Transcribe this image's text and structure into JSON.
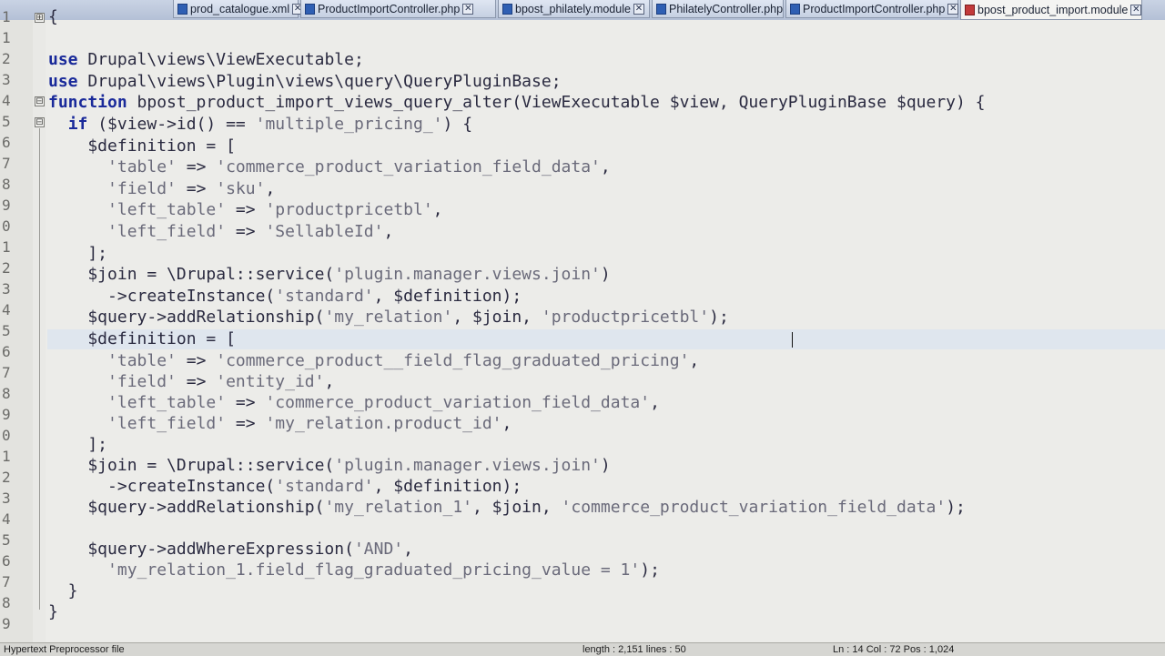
{
  "tabs": [
    {
      "label": "prod_catalogue.xml",
      "active": false
    },
    {
      "label": "ProductImportController.php",
      "active": false
    },
    {
      "label": "bpost_philately.module",
      "active": false
    },
    {
      "label": "PhilatelyController.php",
      "active": false
    },
    {
      "label": "ProductImportController.php",
      "active": false
    },
    {
      "label": "bpost_product_import.module",
      "active": true
    }
  ],
  "line_numbers": [
    "1",
    "1",
    "2",
    "3",
    "4",
    "5",
    "6",
    "7",
    "8",
    "9",
    "0",
    "1",
    "2",
    "3",
    "4",
    "5",
    "6",
    "7",
    "8",
    "9",
    "0",
    "1",
    "2",
    "3",
    "4",
    "5",
    "6",
    "7",
    "8",
    "9"
  ],
  "code_lines": [
    "{",
    "",
    "use Drupal\\views\\ViewExecutable;",
    "use Drupal\\views\\Plugin\\views\\query\\QueryPluginBase;",
    "function bpost_product_import_views_query_alter(ViewExecutable $view, QueryPluginBase $query) {",
    "  if ($view->id() == 'multiple_pricing_') {",
    "    $definition = [",
    "      'table' => 'commerce_product_variation_field_data',",
    "      'field' => 'sku',",
    "      'left_table' => 'productpricetbl',",
    "      'left_field' => 'SellableId',",
    "    ];",
    "    $join = \\Drupal::service('plugin.manager.views.join')",
    "      ->createInstance('standard', $definition);",
    "    $query->addRelationship('my_relation', $join, 'productpricetbl');",
    "    $definition = [",
    "      'table' => 'commerce_product__field_flag_graduated_pricing',",
    "      'field' => 'entity_id',",
    "      'left_table' => 'commerce_product_variation_field_data',",
    "      'left_field' => 'my_relation.product_id',",
    "    ];",
    "    $join = \\Drupal::service('plugin.manager.views.join')",
    "      ->createInstance('standard', $definition);",
    "    $query->addRelationship('my_relation_1', $join, 'commerce_product_variation_field_data');",
    "",
    "    $query->addWhereExpression('AND',",
    "      'my_relation_1.field_flag_graduated_pricing_value = 1');",
    "  }",
    "}",
    ""
  ],
  "statusbar": {
    "language": "Hypertext Preprocessor file",
    "length": "length : 2,151    lines : 50",
    "position": "Ln : 14    Col : 72    Pos : 1,024"
  }
}
